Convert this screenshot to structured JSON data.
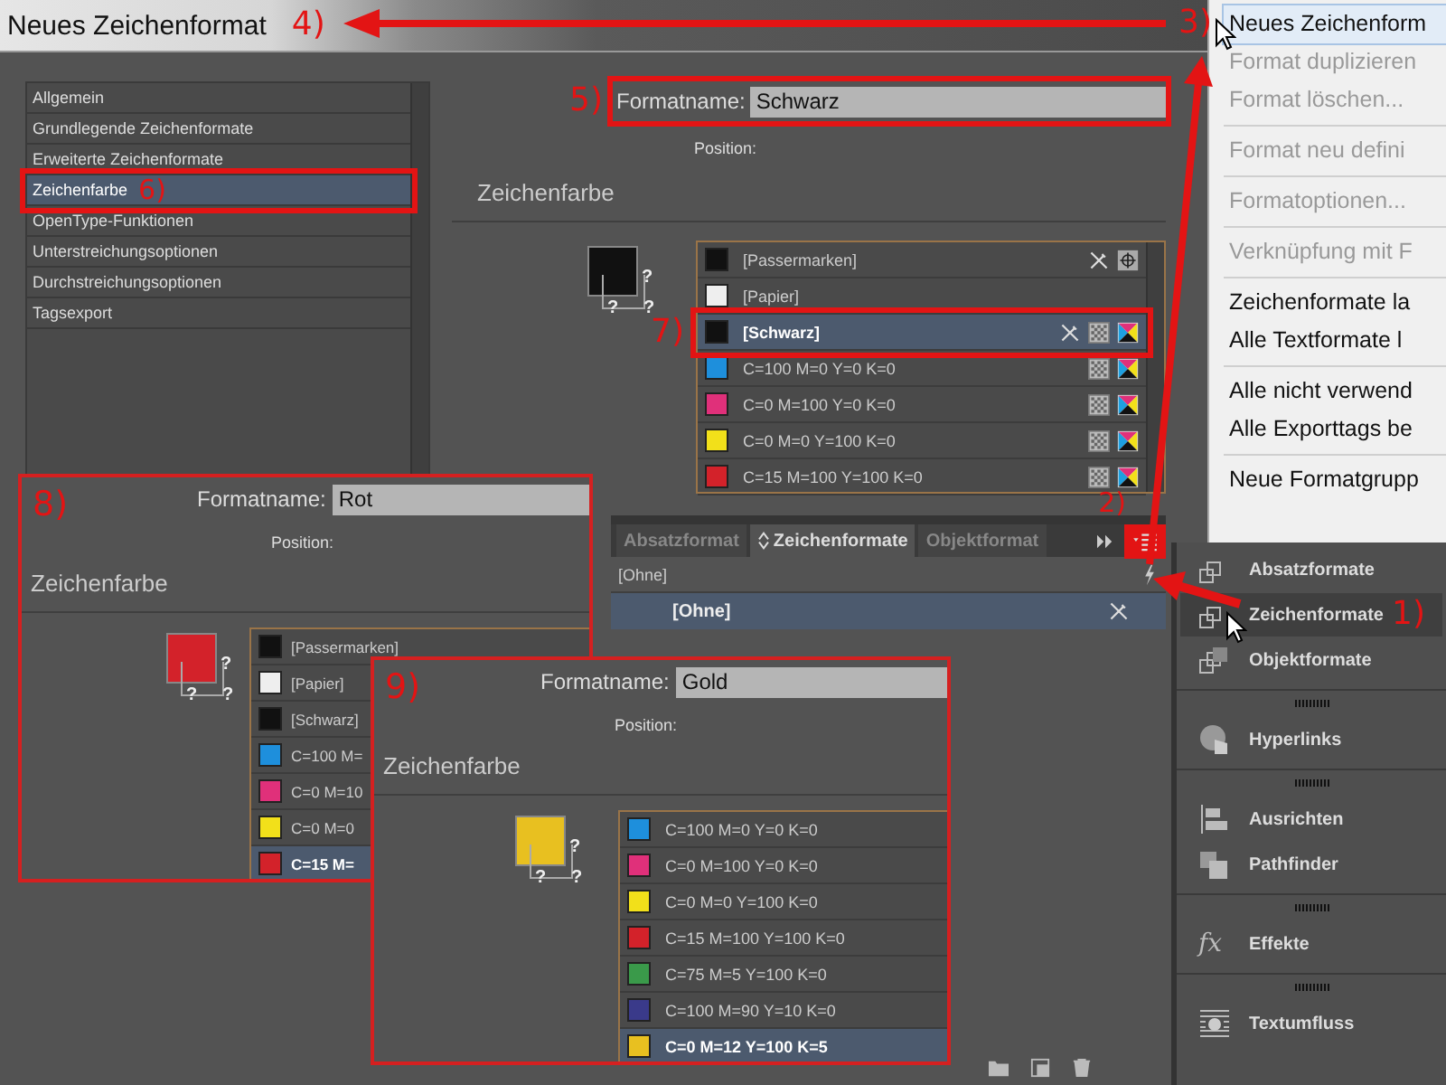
{
  "window": {
    "title": "Neues Zeichenformat",
    "step": "4)"
  },
  "dialog": {
    "categories": [
      {
        "label": "Allgemein",
        "selected": false
      },
      {
        "label": "Grundlegende Zeichenformate",
        "selected": false
      },
      {
        "label": "Erweiterte Zeichenformate",
        "selected": false
      },
      {
        "label": "Zeichenfarbe",
        "selected": true,
        "step": "6)"
      },
      {
        "label": "OpenType-Funktionen",
        "selected": false
      },
      {
        "label": "Unterstreichungsoptionen",
        "selected": false
      },
      {
        "label": "Durchstreichungsoptionen",
        "selected": false
      },
      {
        "label": "Tagsexport",
        "selected": false
      }
    ],
    "name_step": "5)",
    "format_name_label": "Formatname:",
    "format_name": "Schwarz",
    "position_label": "Position:",
    "section_title": "Zeichenfarbe",
    "unknown_marks": [
      "?",
      "?",
      "?"
    ],
    "swatches": [
      {
        "name": "[Passermarken]",
        "color": "#111111",
        "kind": "registration",
        "selected": false
      },
      {
        "name": "[Papier]",
        "color": "#eeeeee",
        "kind": "paper",
        "selected": false
      },
      {
        "name": "[Schwarz]",
        "color": "#111111",
        "kind": "locked",
        "selected": true,
        "step": "7)"
      },
      {
        "name": "C=100 M=0 Y=0 K=0",
        "color": "#1e8fdc",
        "kind": "process",
        "selected": false
      },
      {
        "name": "C=0 M=100 Y=0 K=0",
        "color": "#e0307a",
        "kind": "process",
        "selected": false
      },
      {
        "name": "C=0 M=0 Y=100 K=0",
        "color": "#f2e01a",
        "kind": "process",
        "selected": false
      },
      {
        "name": "C=15 M=100 Y=100 K=0",
        "color": "#d3222a",
        "kind": "process",
        "selected": false
      }
    ]
  },
  "context_menu": {
    "step": "3)",
    "groups": [
      [
        {
          "label": "Neues Zeichenform",
          "disabled": false,
          "selected": true
        },
        {
          "label": "Format duplizieren",
          "disabled": true,
          "selected": false
        },
        {
          "label": "Format löschen...",
          "disabled": true,
          "selected": false
        }
      ],
      [
        {
          "label": "Format neu defini",
          "disabled": true,
          "selected": false
        }
      ],
      [
        {
          "label": "Formatoptionen...",
          "disabled": true,
          "selected": false
        }
      ],
      [
        {
          "label": "Verknüpfung mit F",
          "disabled": true,
          "selected": false
        }
      ],
      [
        {
          "label": "Zeichenformate la",
          "disabled": false,
          "selected": false
        },
        {
          "label": "Alle Textformate l",
          "disabled": false,
          "selected": false
        }
      ],
      [
        {
          "label": "Alle nicht verwend",
          "disabled": false,
          "selected": false
        },
        {
          "label": "Alle Exporttags be",
          "disabled": false,
          "selected": false
        }
      ],
      [
        {
          "label": "Neue Formatgrupp",
          "disabled": false,
          "selected": false
        }
      ]
    ]
  },
  "styles_panel": {
    "menu_step": "2)",
    "tabs": [
      {
        "label": "Absatzformat",
        "selected": false
      },
      {
        "label": "Zeichenformate",
        "selected": true
      },
      {
        "label": "Objektformat",
        "selected": false
      }
    ],
    "current": "[Ohne]",
    "rows": [
      {
        "label": "[Ohne]",
        "selected": true
      }
    ]
  },
  "side_panel": {
    "groups": [
      [
        {
          "label": "Absatzformate",
          "kind": "paragraph",
          "selected": false
        },
        {
          "label": "Zeichenformate",
          "kind": "character",
          "selected": true,
          "step": "1)"
        },
        {
          "label": "Objektformate",
          "kind": "object",
          "selected": false
        }
      ],
      [
        {
          "label": "Hyperlinks",
          "kind": "hyperlinks",
          "selected": false
        }
      ],
      [
        {
          "label": "Ausrichten",
          "kind": "align",
          "selected": false
        },
        {
          "label": "Pathfinder",
          "kind": "pathfinder",
          "selected": false
        }
      ],
      [
        {
          "label": "Effekte",
          "kind": "effects",
          "icon": "fx",
          "selected": false
        }
      ],
      [
        {
          "label": "Textumfluss",
          "kind": "wrap",
          "selected": false
        }
      ]
    ]
  },
  "overlays": [
    {
      "step": "8)",
      "format_name_label": "Formatname:",
      "format_name": "Rot",
      "position_label": "Position:",
      "section_title": "Zeichenfarbe",
      "unknown_marks": [
        "?",
        "?",
        "?"
      ],
      "swatches": [
        {
          "name": "[Passermarken]",
          "color": "#111111",
          "selected": false
        },
        {
          "name": "[Papier]",
          "color": "#eeeeee",
          "selected": false
        },
        {
          "name": "[Schwarz]",
          "color": "#111111",
          "selected": false
        },
        {
          "name": "C=100 M=",
          "color": "#1e8fdc",
          "selected": false
        },
        {
          "name": "C=0 M=10",
          "color": "#e0307a",
          "selected": false
        },
        {
          "name": "C=0 M=0",
          "color": "#f2e01a",
          "selected": false
        },
        {
          "name": "C=15 M=",
          "color": "#d3222a",
          "selected": true
        }
      ]
    },
    {
      "step": "9)",
      "format_name_label": "Formatname:",
      "format_name": "Gold",
      "position_label": "Position:",
      "section_title": "Zeichenfarbe",
      "unknown_marks": [
        "?",
        "?",
        "?"
      ],
      "swatches": [
        {
          "name": "C=100 M=0 Y=0 K=0",
          "color": "#1e8fdc",
          "selected": false
        },
        {
          "name": "C=0 M=100 Y=0 K=0",
          "color": "#e0307a",
          "selected": false
        },
        {
          "name": "C=0 M=0 Y=100 K=0",
          "color": "#f2e01a",
          "selected": false
        },
        {
          "name": "C=15 M=100 Y=100 K=0",
          "color": "#d3222a",
          "selected": false
        },
        {
          "name": "C=75 M=5 Y=100 K=0",
          "color": "#3a9a4a",
          "selected": false
        },
        {
          "name": "C=100 M=90 Y=10 K=0",
          "color": "#3a3a8a",
          "selected": false
        },
        {
          "name": "C=0 M=12 Y=100 K=5",
          "color": "#e8c020",
          "selected": true
        }
      ]
    }
  ]
}
